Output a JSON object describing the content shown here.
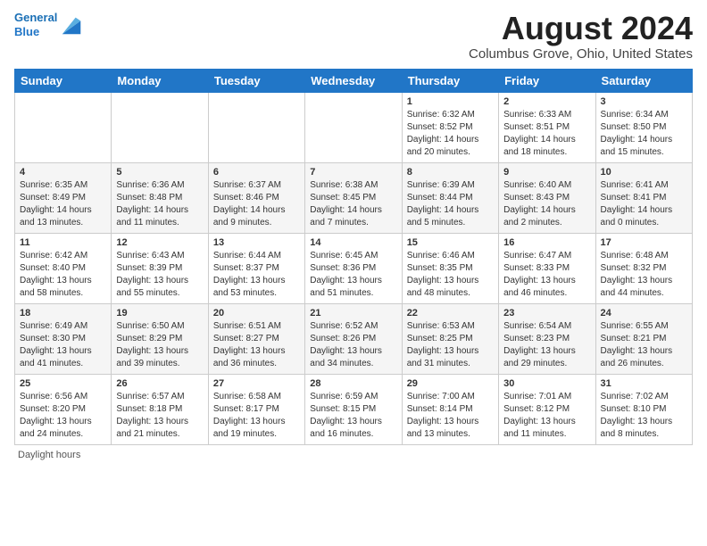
{
  "header": {
    "logo_line1": "General",
    "logo_line2": "Blue",
    "month_title": "August 2024",
    "location": "Columbus Grove, Ohio, United States"
  },
  "days_of_week": [
    "Sunday",
    "Monday",
    "Tuesday",
    "Wednesday",
    "Thursday",
    "Friday",
    "Saturday"
  ],
  "weeks": [
    [
      {
        "day": "",
        "sunrise": "",
        "sunset": "",
        "daylight": ""
      },
      {
        "day": "",
        "sunrise": "",
        "sunset": "",
        "daylight": ""
      },
      {
        "day": "",
        "sunrise": "",
        "sunset": "",
        "daylight": ""
      },
      {
        "day": "",
        "sunrise": "",
        "sunset": "",
        "daylight": ""
      },
      {
        "day": "1",
        "sunrise": "Sunrise: 6:32 AM",
        "sunset": "Sunset: 8:52 PM",
        "daylight": "Daylight: 14 hours and 20 minutes."
      },
      {
        "day": "2",
        "sunrise": "Sunrise: 6:33 AM",
        "sunset": "Sunset: 8:51 PM",
        "daylight": "Daylight: 14 hours and 18 minutes."
      },
      {
        "day": "3",
        "sunrise": "Sunrise: 6:34 AM",
        "sunset": "Sunset: 8:50 PM",
        "daylight": "Daylight: 14 hours and 15 minutes."
      }
    ],
    [
      {
        "day": "4",
        "sunrise": "Sunrise: 6:35 AM",
        "sunset": "Sunset: 8:49 PM",
        "daylight": "Daylight: 14 hours and 13 minutes."
      },
      {
        "day": "5",
        "sunrise": "Sunrise: 6:36 AM",
        "sunset": "Sunset: 8:48 PM",
        "daylight": "Daylight: 14 hours and 11 minutes."
      },
      {
        "day": "6",
        "sunrise": "Sunrise: 6:37 AM",
        "sunset": "Sunset: 8:46 PM",
        "daylight": "Daylight: 14 hours and 9 minutes."
      },
      {
        "day": "7",
        "sunrise": "Sunrise: 6:38 AM",
        "sunset": "Sunset: 8:45 PM",
        "daylight": "Daylight: 14 hours and 7 minutes."
      },
      {
        "day": "8",
        "sunrise": "Sunrise: 6:39 AM",
        "sunset": "Sunset: 8:44 PM",
        "daylight": "Daylight: 14 hours and 5 minutes."
      },
      {
        "day": "9",
        "sunrise": "Sunrise: 6:40 AM",
        "sunset": "Sunset: 8:43 PM",
        "daylight": "Daylight: 14 hours and 2 minutes."
      },
      {
        "day": "10",
        "sunrise": "Sunrise: 6:41 AM",
        "sunset": "Sunset: 8:41 PM",
        "daylight": "Daylight: 14 hours and 0 minutes."
      }
    ],
    [
      {
        "day": "11",
        "sunrise": "Sunrise: 6:42 AM",
        "sunset": "Sunset: 8:40 PM",
        "daylight": "Daylight: 13 hours and 58 minutes."
      },
      {
        "day": "12",
        "sunrise": "Sunrise: 6:43 AM",
        "sunset": "Sunset: 8:39 PM",
        "daylight": "Daylight: 13 hours and 55 minutes."
      },
      {
        "day": "13",
        "sunrise": "Sunrise: 6:44 AM",
        "sunset": "Sunset: 8:37 PM",
        "daylight": "Daylight: 13 hours and 53 minutes."
      },
      {
        "day": "14",
        "sunrise": "Sunrise: 6:45 AM",
        "sunset": "Sunset: 8:36 PM",
        "daylight": "Daylight: 13 hours and 51 minutes."
      },
      {
        "day": "15",
        "sunrise": "Sunrise: 6:46 AM",
        "sunset": "Sunset: 8:35 PM",
        "daylight": "Daylight: 13 hours and 48 minutes."
      },
      {
        "day": "16",
        "sunrise": "Sunrise: 6:47 AM",
        "sunset": "Sunset: 8:33 PM",
        "daylight": "Daylight: 13 hours and 46 minutes."
      },
      {
        "day": "17",
        "sunrise": "Sunrise: 6:48 AM",
        "sunset": "Sunset: 8:32 PM",
        "daylight": "Daylight: 13 hours and 44 minutes."
      }
    ],
    [
      {
        "day": "18",
        "sunrise": "Sunrise: 6:49 AM",
        "sunset": "Sunset: 8:30 PM",
        "daylight": "Daylight: 13 hours and 41 minutes."
      },
      {
        "day": "19",
        "sunrise": "Sunrise: 6:50 AM",
        "sunset": "Sunset: 8:29 PM",
        "daylight": "Daylight: 13 hours and 39 minutes."
      },
      {
        "day": "20",
        "sunrise": "Sunrise: 6:51 AM",
        "sunset": "Sunset: 8:27 PM",
        "daylight": "Daylight: 13 hours and 36 minutes."
      },
      {
        "day": "21",
        "sunrise": "Sunrise: 6:52 AM",
        "sunset": "Sunset: 8:26 PM",
        "daylight": "Daylight: 13 hours and 34 minutes."
      },
      {
        "day": "22",
        "sunrise": "Sunrise: 6:53 AM",
        "sunset": "Sunset: 8:25 PM",
        "daylight": "Daylight: 13 hours and 31 minutes."
      },
      {
        "day": "23",
        "sunrise": "Sunrise: 6:54 AM",
        "sunset": "Sunset: 8:23 PM",
        "daylight": "Daylight: 13 hours and 29 minutes."
      },
      {
        "day": "24",
        "sunrise": "Sunrise: 6:55 AM",
        "sunset": "Sunset: 8:21 PM",
        "daylight": "Daylight: 13 hours and 26 minutes."
      }
    ],
    [
      {
        "day": "25",
        "sunrise": "Sunrise: 6:56 AM",
        "sunset": "Sunset: 8:20 PM",
        "daylight": "Daylight: 13 hours and 24 minutes."
      },
      {
        "day": "26",
        "sunrise": "Sunrise: 6:57 AM",
        "sunset": "Sunset: 8:18 PM",
        "daylight": "Daylight: 13 hours and 21 minutes."
      },
      {
        "day": "27",
        "sunrise": "Sunrise: 6:58 AM",
        "sunset": "Sunset: 8:17 PM",
        "daylight": "Daylight: 13 hours and 19 minutes."
      },
      {
        "day": "28",
        "sunrise": "Sunrise: 6:59 AM",
        "sunset": "Sunset: 8:15 PM",
        "daylight": "Daylight: 13 hours and 16 minutes."
      },
      {
        "day": "29",
        "sunrise": "Sunrise: 7:00 AM",
        "sunset": "Sunset: 8:14 PM",
        "daylight": "Daylight: 13 hours and 13 minutes."
      },
      {
        "day": "30",
        "sunrise": "Sunrise: 7:01 AM",
        "sunset": "Sunset: 8:12 PM",
        "daylight": "Daylight: 13 hours and 11 minutes."
      },
      {
        "day": "31",
        "sunrise": "Sunrise: 7:02 AM",
        "sunset": "Sunset: 8:10 PM",
        "daylight": "Daylight: 13 hours and 8 minutes."
      }
    ]
  ],
  "footer": {
    "note": "Daylight hours"
  }
}
